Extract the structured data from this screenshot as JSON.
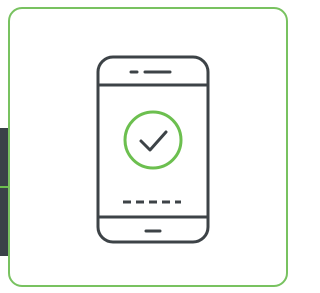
{
  "card": {
    "border_color": "#78c260"
  },
  "illustration": {
    "icon": "smartphone-verified-icon",
    "outline_color": "#3d4347",
    "accent_color": "#6cbf4f"
  },
  "backdrop": {
    "strip_color": "#3a4148"
  }
}
